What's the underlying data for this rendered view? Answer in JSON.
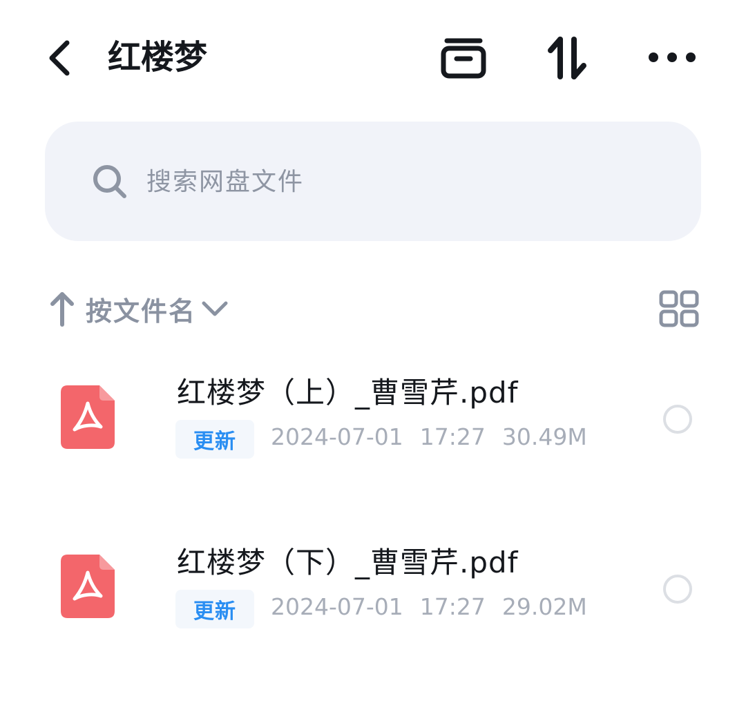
{
  "header": {
    "title": "红楼梦",
    "icons": {
      "back": "chevron-left-icon",
      "archive": "archive-box-icon",
      "sort": "sort-arrows-icon",
      "more": "more-dots-icon"
    }
  },
  "search": {
    "placeholder": "搜索网盘文件",
    "value": ""
  },
  "sort_bar": {
    "label": "按文件名",
    "direction": "ascending",
    "icons": {
      "direction": "arrow-up-icon",
      "dropdown": "chevron-down-icon",
      "view": "grid-view-icon"
    }
  },
  "files": [
    {
      "name": "红楼梦（上）_曹雪芹.pdf",
      "badge": "更新",
      "date": "2024-07-01",
      "time": "17:27",
      "size": "30.49M",
      "icon": "pdf-file-icon",
      "selected": false
    },
    {
      "name": "红楼梦（下）_曹雪芹.pdf",
      "badge": "更新",
      "date": "2024-07-01",
      "time": "17:27",
      "size": "29.02M",
      "icon": "pdf-file-icon",
      "selected": false
    }
  ],
  "colors": {
    "title_text": "#15181d",
    "search_bg": "#f1f3f9",
    "muted_text": "#8a92a1",
    "meta_text": "#a7adb8",
    "badge_text": "#2a8ef2",
    "badge_bg": "#f3f7fc",
    "pdf_icon": "#f3666b"
  }
}
